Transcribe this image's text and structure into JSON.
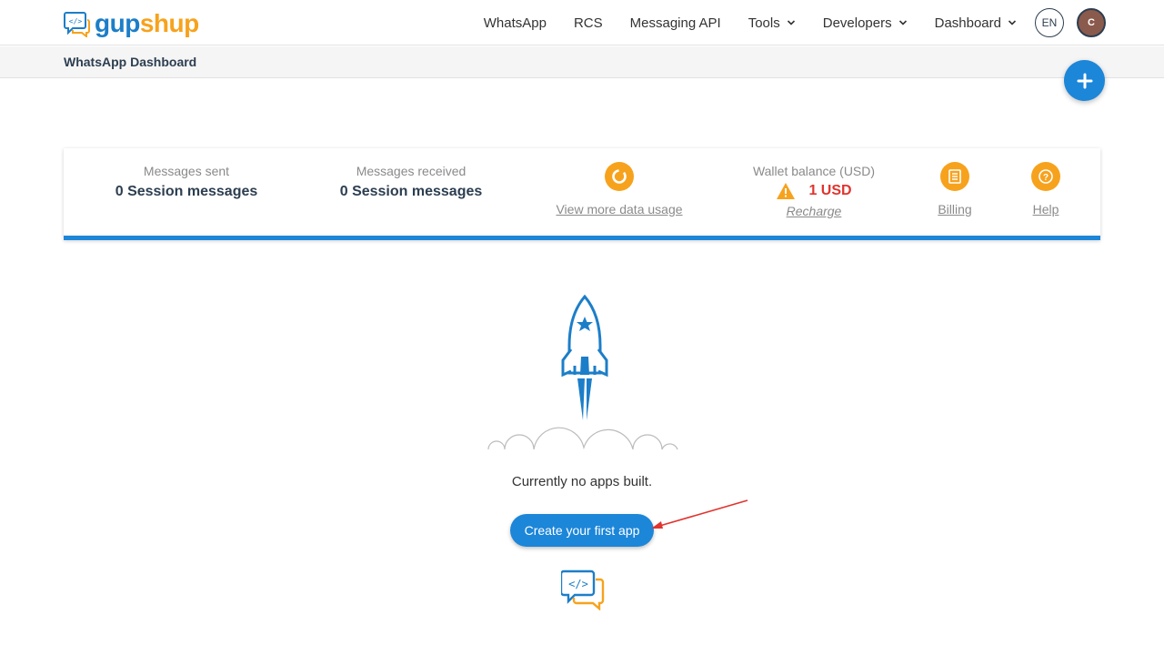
{
  "brand": {
    "name_part1": "gup",
    "name_part2": "shup",
    "primary_color": "#1c86d9",
    "accent_color": "#f7a21d"
  },
  "nav": {
    "items": [
      {
        "label": "WhatsApp",
        "dropdown": false
      },
      {
        "label": "RCS",
        "dropdown": false
      },
      {
        "label": "Messaging API",
        "dropdown": false
      },
      {
        "label": "Tools",
        "dropdown": true
      },
      {
        "label": "Developers",
        "dropdown": true
      },
      {
        "label": "Dashboard",
        "dropdown": true
      }
    ],
    "language": "EN",
    "avatar_initial": "C"
  },
  "page": {
    "title": "WhatsApp Dashboard"
  },
  "stats": {
    "messages_sent_label": "Messages sent",
    "messages_sent_value": "0 Session messages",
    "messages_received_label": "Messages received",
    "messages_received_value": "0 Session messages",
    "data_usage_link": "View more data usage",
    "wallet_label": "Wallet balance (USD)",
    "wallet_amount": "1 USD",
    "recharge_link": "Recharge",
    "billing_link": "Billing",
    "help_link": "Help"
  },
  "empty_state": {
    "message": "Currently no apps built.",
    "cta_label": "Create your first app"
  }
}
